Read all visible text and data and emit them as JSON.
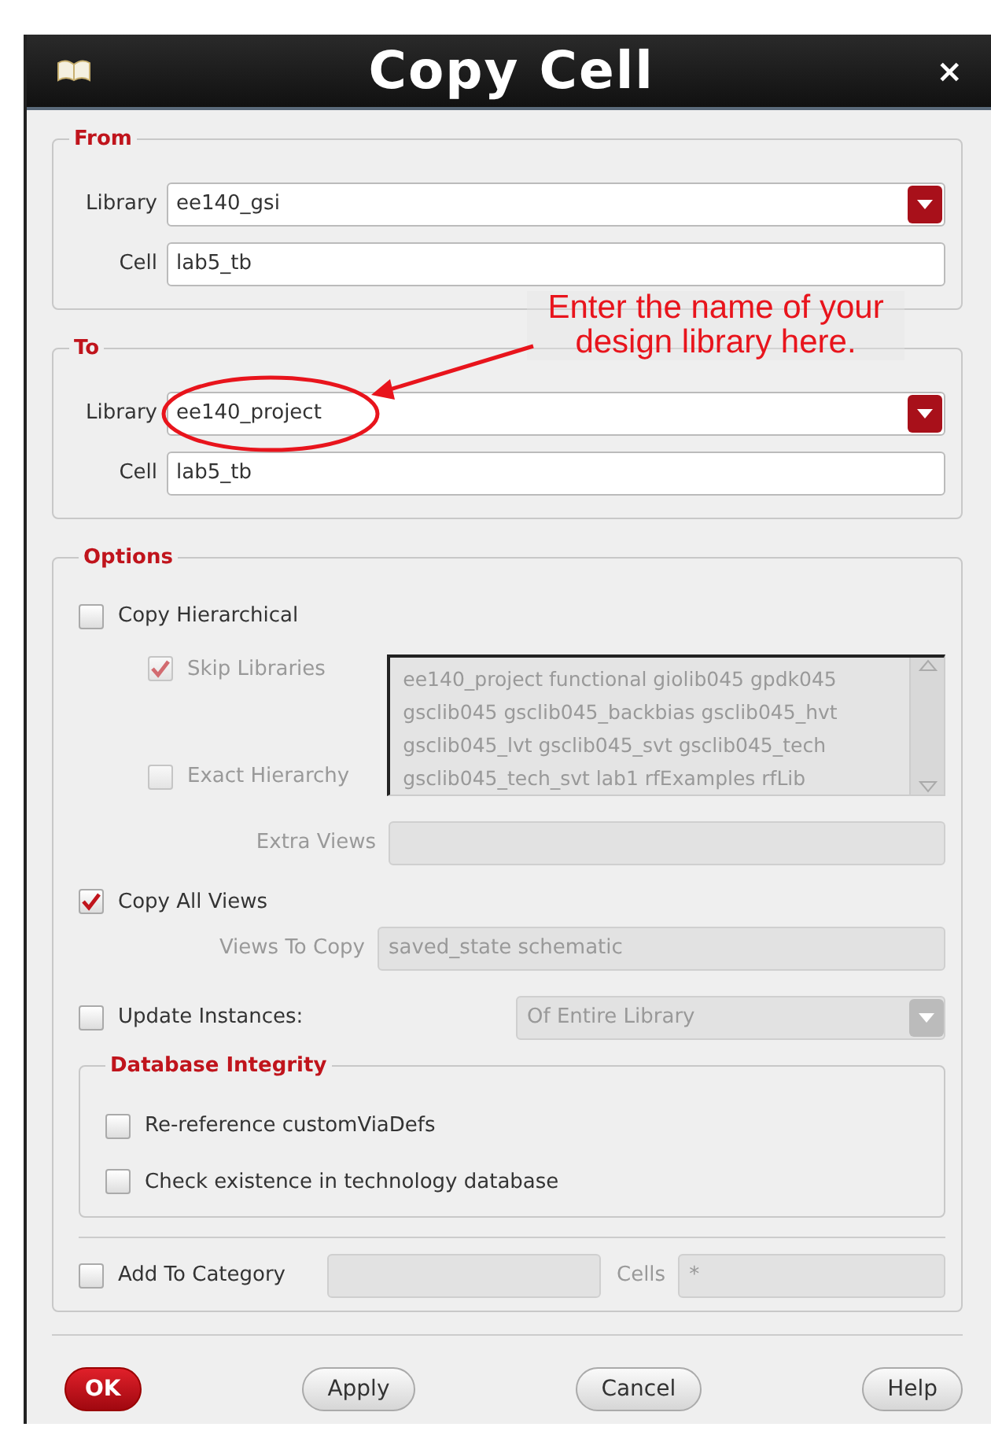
{
  "window": {
    "title": "Copy Cell",
    "close": "×"
  },
  "from": {
    "legend": "From",
    "library_label": "Library",
    "library": "ee140_gsi",
    "cell_label": "Cell",
    "cell": "lab5_tb"
  },
  "to": {
    "legend": "To",
    "library_label": "Library",
    "library": "ee140_project",
    "cell_label": "Cell",
    "cell": "lab5_tb"
  },
  "annotation": {
    "text": "Enter the name of your design library here."
  },
  "options": {
    "legend": "Options",
    "copy_hierarchical": {
      "label": "Copy Hierarchical",
      "checked": false
    },
    "skip_libraries": {
      "label": "Skip Libraries",
      "checked": true,
      "disabled": true
    },
    "library_list": [
      "ee140_project functional giolib045 gpdk045",
      "gsclib045 gsclib045_backbias gsclib045_hvt",
      "gsclib045_lvt gsclib045_svt gsclib045_tech",
      "gsclib045_tech_svt lab1 rfExamples rfLib"
    ],
    "exact_hierarchy": {
      "label": "Exact Hierarchy",
      "checked": false,
      "disabled": true
    },
    "extra_views": {
      "label": "Extra Views"
    },
    "copy_all_views": {
      "label": "Copy All Views",
      "checked": true
    },
    "views_to_copy": {
      "label": "Views To Copy",
      "value": "saved_state schematic"
    },
    "update_instances": {
      "label": "Update Instances:",
      "checked": false
    },
    "update_scope": {
      "value": "Of Entire Library"
    },
    "database_integrity": {
      "legend": "Database Integrity",
      "items": [
        {
          "label": "Re-reference customViaDefs",
          "checked": false
        },
        {
          "label": "Check existence in technology database",
          "checked": false
        }
      ]
    },
    "add_to_category": {
      "label": "Add To Category",
      "checked": false
    },
    "cells": {
      "label": "Cells",
      "value": "*"
    }
  },
  "buttons": [
    {
      "label": "OK",
      "kind": "primary"
    },
    {
      "label": "Apply",
      "kind": "normal"
    },
    {
      "label": "Cancel",
      "kind": "normal"
    },
    {
      "label": "Help",
      "kind": "normal"
    }
  ]
}
